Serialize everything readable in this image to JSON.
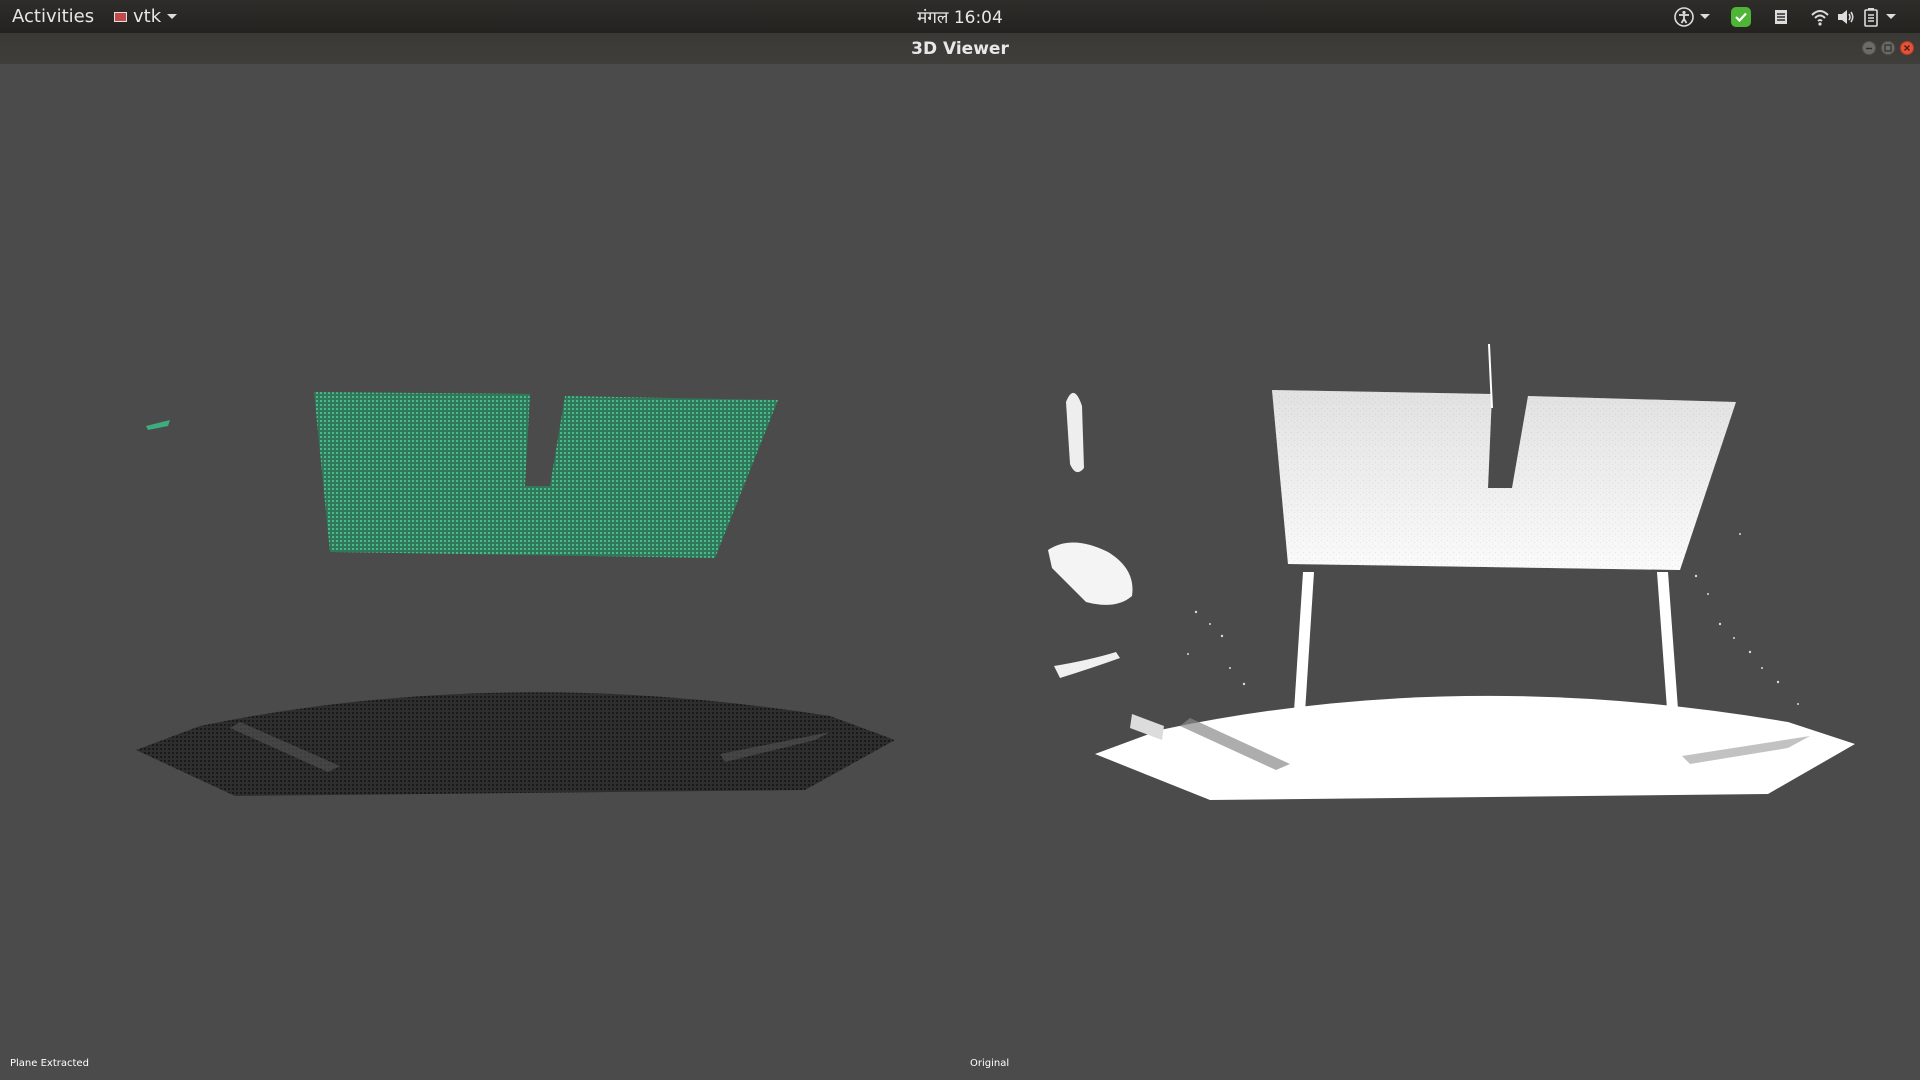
{
  "topbar": {
    "activities_label": "Activities",
    "app_menu": {
      "label": "vtk",
      "icon": "vtk-app-icon"
    },
    "clock": "मंगल 16:04",
    "tray": [
      {
        "name": "accessibility-icon",
        "has_menu": true
      },
      {
        "name": "software-update-check-icon",
        "color": "#4fb537"
      },
      {
        "name": "notes-icon"
      },
      {
        "name": "wifi-icon"
      },
      {
        "name": "volume-icon"
      },
      {
        "name": "battery-icon",
        "has_menu": true
      }
    ]
  },
  "window": {
    "title": "3D Viewer",
    "controls": [
      "minimize-button",
      "maximize-button",
      "close-button"
    ]
  },
  "viewports": {
    "left": {
      "label": "Plane Extracted",
      "background": "#4b4b4b",
      "plane_color": "#3dac7e",
      "floor_color": "#1e1e1e"
    },
    "right": {
      "label": "Original",
      "background": "#4b4b4b",
      "cloud_color": "#ffffff"
    }
  }
}
